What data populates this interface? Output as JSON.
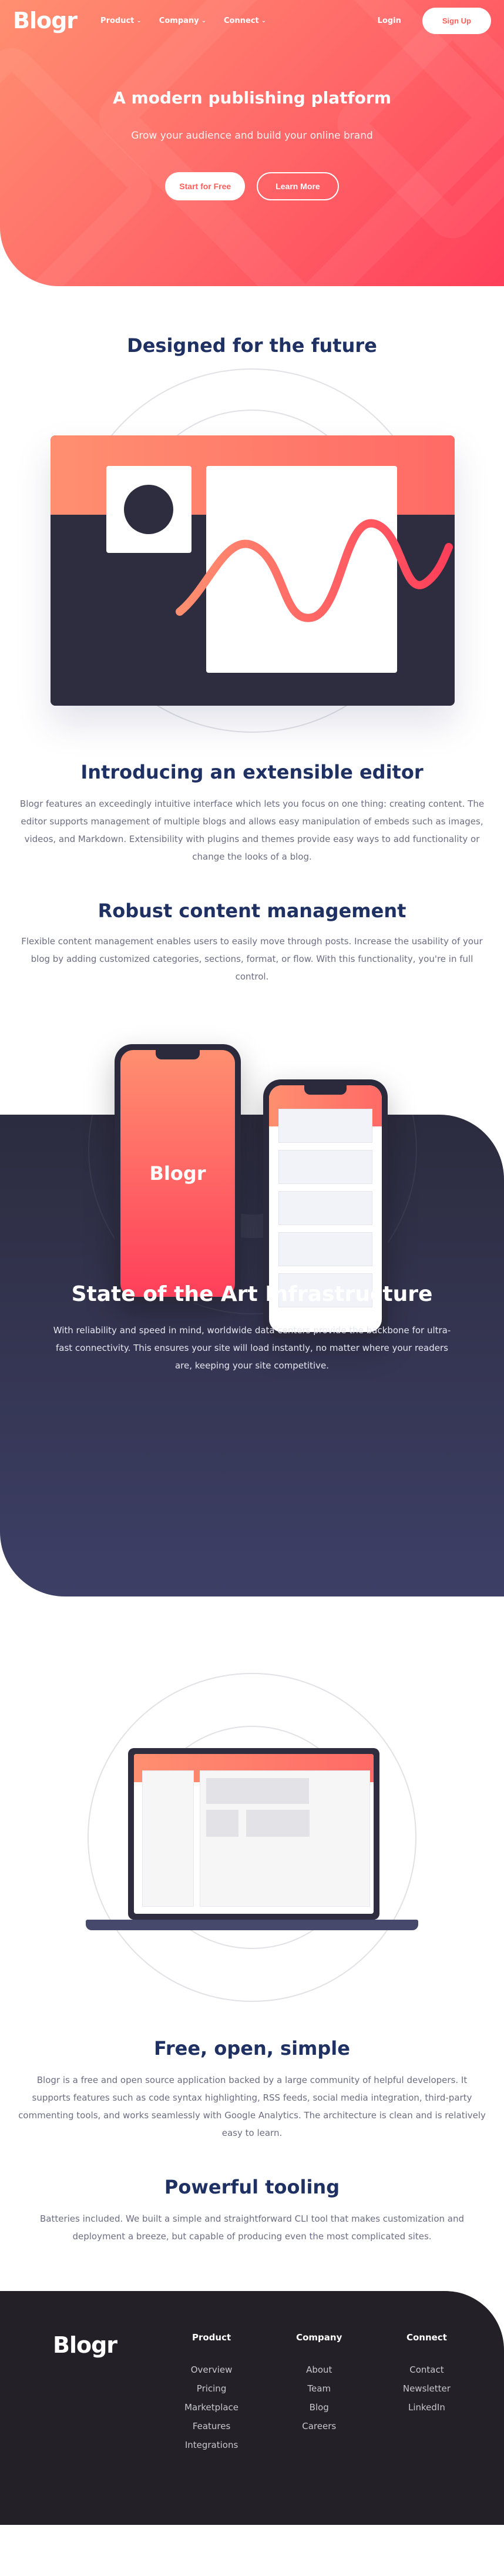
{
  "brand": "Blogr",
  "colors": {
    "primary_gradient_start": "#ff8f70",
    "primary_gradient_end": "#ff3f5a",
    "dark_blue": "#1f3163",
    "dark_bg": "#2c2c3f",
    "footer_bg": "#232127"
  },
  "nav": {
    "items": [
      {
        "label": "Product",
        "icon": "chevron-down-icon"
      },
      {
        "label": "Company",
        "icon": "chevron-down-icon"
      },
      {
        "label": "Connect",
        "icon": "chevron-down-icon"
      }
    ],
    "login": "Login",
    "signup": "Sign Up"
  },
  "hero": {
    "title": "A modern publishing platform",
    "subtitle": "Grow your audience and build your online brand",
    "cta_primary": "Start for Free",
    "cta_secondary": "Learn More"
  },
  "sections": {
    "designed": {
      "title": "Designed for the future"
    },
    "editor": {
      "title": "Introducing an extensible editor",
      "body": "Blogr features an exceedingly intuitive interface which lets you focus on one thing: creating content. The editor supports management of multiple blogs and allows easy manipulation of embeds such as images, videos, and Markdown. Extensibility with plugins and themes provide easy ways to add functionality or change the looks of a blog."
    },
    "robust": {
      "title": "Robust content management",
      "body": "Flexible content management enables users to easily move through posts. Increase the usability of your blog by adding customized categories, sections, format, or flow. With this functionality, you're in full control."
    },
    "infra": {
      "phone_logo": "Blogr",
      "title": "State of the Art Infrastructure",
      "body": "With reliability and speed in mind, worldwide data centers provide the backbone for ultra-fast connectivity. This ensures your site will load instantly, no matter where your readers are, keeping your site competitive."
    },
    "free": {
      "title": "Free, open, simple",
      "body": "Blogr is a free and open source application backed by a large community of helpful developers. It supports features such as code syntax highlighting, RSS feeds, social media integration, third-party commenting tools, and works seamlessly with Google Analytics. The architecture is clean and is relatively easy to learn."
    },
    "tooling": {
      "title": "Powerful tooling",
      "body": "Batteries included. We built a simple and straightforward CLI tool that makes customization and deployment a breeze, but capable of producing even the most complicated sites."
    }
  },
  "footer": {
    "logo": "Blogr",
    "columns": [
      {
        "heading": "Product",
        "links": [
          "Overview",
          "Pricing",
          "Marketplace",
          "Features",
          "Integrations"
        ]
      },
      {
        "heading": "Company",
        "links": [
          "About",
          "Team",
          "Blog",
          "Careers"
        ]
      },
      {
        "heading": "Connect",
        "links": [
          "Contact",
          "Newsletter",
          "LinkedIn"
        ]
      }
    ]
  }
}
